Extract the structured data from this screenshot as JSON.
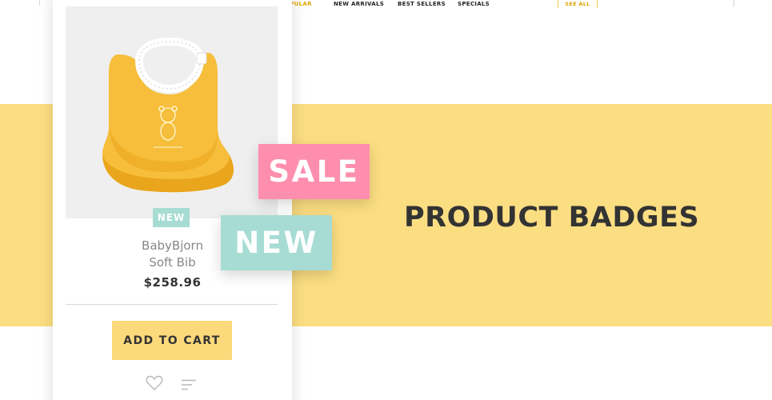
{
  "nav": {
    "items": [
      {
        "label": "OPULAR",
        "active": true
      },
      {
        "label": "NEW ARRIVALS",
        "active": false
      },
      {
        "label": "BEST SELLERS",
        "active": false
      },
      {
        "label": "SPECIALS",
        "active": false
      }
    ],
    "see_all": "SEE ALL"
  },
  "banner": {
    "title": "PRODUCT BADGES",
    "background": "#fcde82"
  },
  "product": {
    "brand_line": "BabyBjorn",
    "name_line": "Soft Bib",
    "price": "$258.96",
    "badge": "NEW",
    "add_to_cart": "ADD TO CART",
    "image_icon": "yellow-bib-image"
  },
  "badges": {
    "sale": {
      "label": "SALE",
      "color": "#fe8eae"
    },
    "new": {
      "label": "NEW",
      "color": "#a6dcd3"
    }
  },
  "colors": {
    "accent_yellow": "#fcd97a",
    "nav_active": "#e0a800"
  }
}
